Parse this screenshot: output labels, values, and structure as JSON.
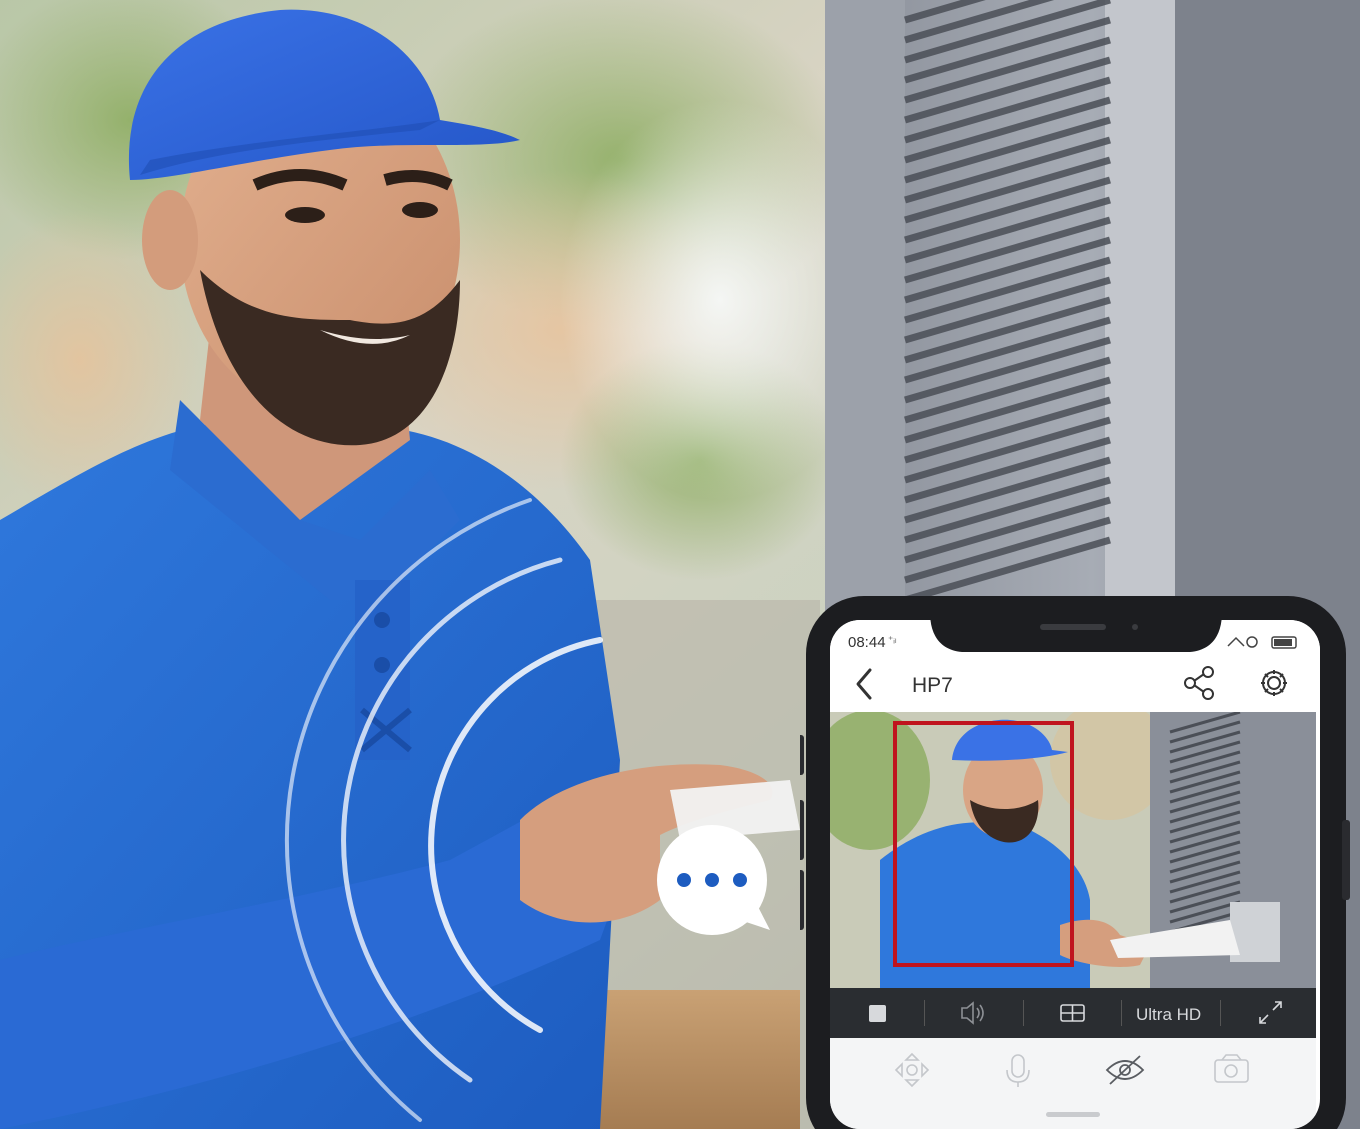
{
  "status_bar": {
    "time": "08:44"
  },
  "app_header": {
    "title": "HP7",
    "back_icon": "chevron-left-icon",
    "share_icon": "share-icon",
    "settings_icon": "gear-icon"
  },
  "video_toolbar": {
    "stop_icon": "stop-icon",
    "volume_icon": "volume-icon",
    "layout_icon": "layout-icon",
    "quality_label": "Ultra HD",
    "fullscreen_icon": "expand-icon"
  },
  "controls": {
    "ptz_icon": "ptz-icon",
    "mic_icon": "microphone-icon",
    "privacy_icon": "eye-off-icon",
    "snapshot_icon": "camera-icon"
  },
  "chat_bubble": {
    "icon": "speech-bubble-icon"
  },
  "detection_box": {
    "color": "#c0141e"
  },
  "colors": {
    "accent_blue": "#2e6fd8",
    "toolbar_dark": "#2a2d31"
  }
}
